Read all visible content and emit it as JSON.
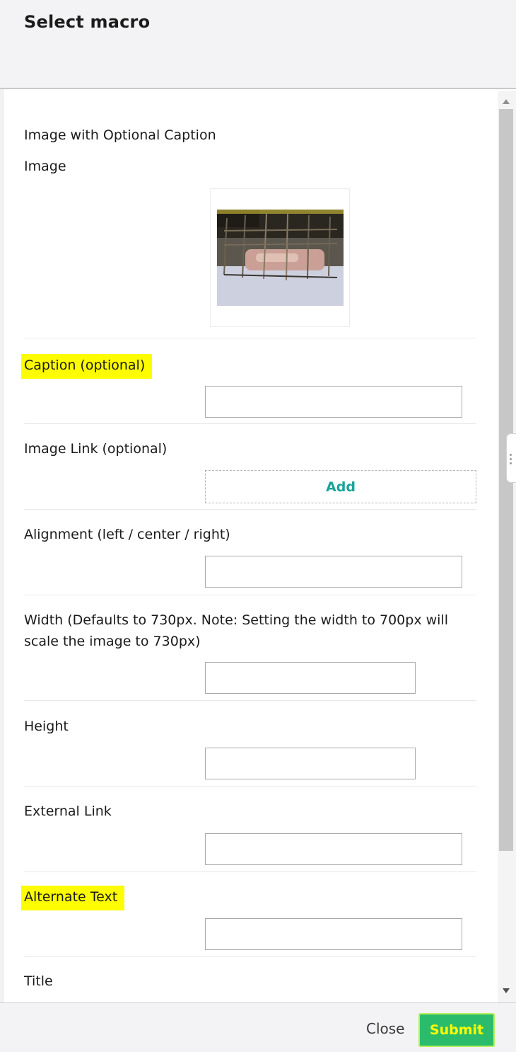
{
  "dialog": {
    "title": "Select macro"
  },
  "macro": {
    "name": "Image with Optional Caption"
  },
  "fields": {
    "image": {
      "label": "Image"
    },
    "caption": {
      "label": "Caption (optional)",
      "value": ""
    },
    "image_link": {
      "label": "Image Link (optional)",
      "add_label": "Add"
    },
    "alignment": {
      "label": "Alignment (left / center / right)",
      "value": ""
    },
    "width": {
      "label_line1": "Width (Defaults to 730px. Note: Setting the width to 700px will",
      "label_line2": "scale the image to 730px)",
      "value": ""
    },
    "height": {
      "label": "Height",
      "value": ""
    },
    "external_link": {
      "label": "External Link",
      "value": ""
    },
    "alternate_text": {
      "label": "Alternate Text",
      "value": ""
    },
    "title": {
      "label": "Title"
    }
  },
  "footer": {
    "close_label": "Close",
    "submit_label": "Submit"
  },
  "colors": {
    "highlight": "#fdfd00",
    "submit_bg": "#2bbc6b",
    "add_text": "#1aa39a"
  }
}
